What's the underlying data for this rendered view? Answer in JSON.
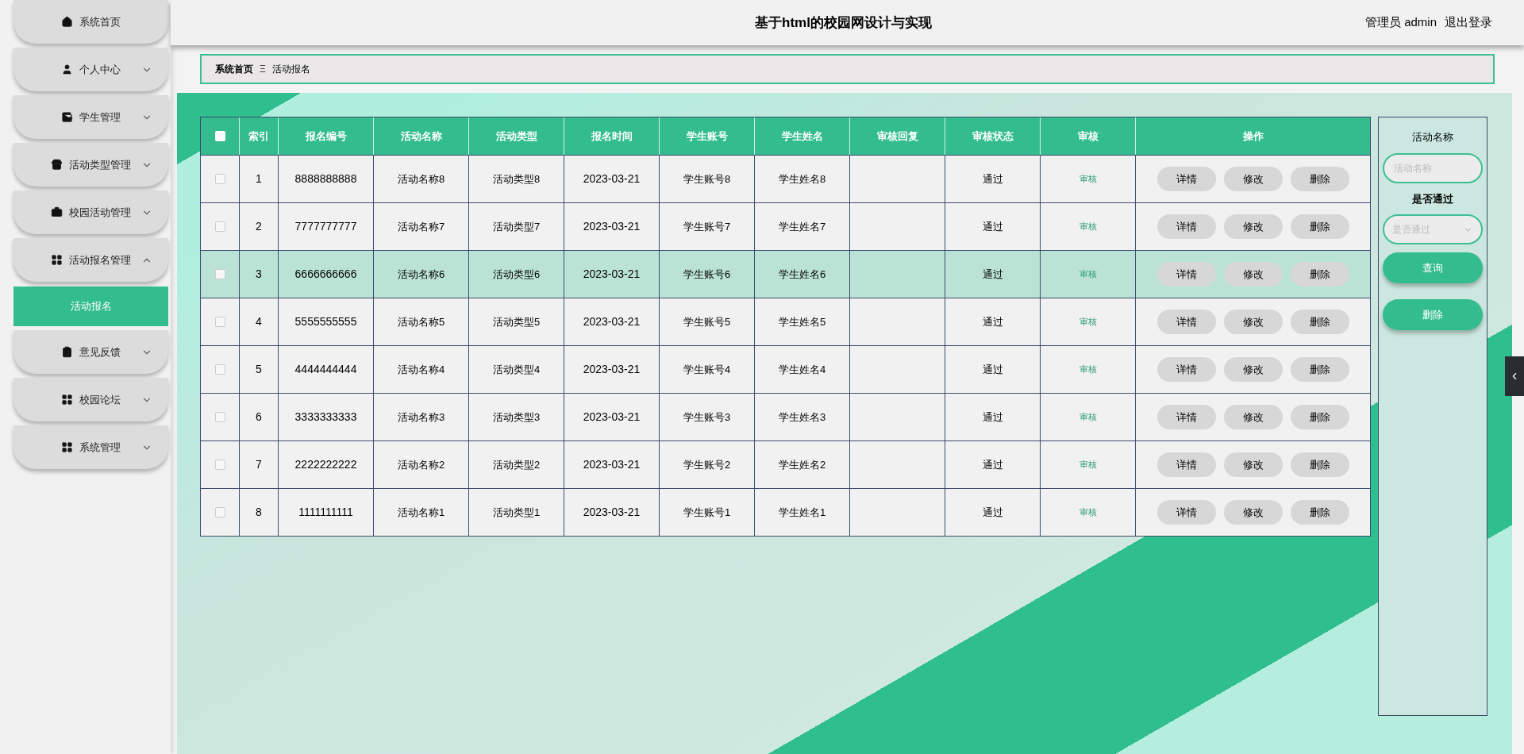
{
  "sidebar": {
    "items": [
      {
        "label": "系统首页",
        "kind": "link"
      },
      {
        "label": "个人中心",
        "kind": "menu",
        "expanded": false
      },
      {
        "label": "学生管理",
        "kind": "menu",
        "expanded": false
      },
      {
        "label": "活动类型管理",
        "kind": "menu",
        "expanded": false
      },
      {
        "label": "校园活动管理",
        "kind": "menu",
        "expanded": false
      },
      {
        "label": "活动报名管理",
        "kind": "menu",
        "expanded": true,
        "children": [
          {
            "label": "活动报名",
            "selected": true
          }
        ]
      },
      {
        "label": "意见反馈",
        "kind": "menu",
        "expanded": false
      },
      {
        "label": "校园论坛",
        "kind": "menu",
        "expanded": false
      },
      {
        "label": "系统管理",
        "kind": "menu",
        "expanded": false
      }
    ]
  },
  "header": {
    "title": "基于html的校园网设计与实现",
    "user": "管理员 admin",
    "logout": "退出登录"
  },
  "breadcrumb": {
    "home": "系统首页",
    "separator": "Ξ",
    "current": "活动报名"
  },
  "table": {
    "columns": [
      "索引",
      "报名编号",
      "活动名称",
      "活动类型",
      "报名时间",
      "学生账号",
      "学生姓名",
      "审核回复",
      "审核状态",
      "审核",
      "操作"
    ],
    "header_checked": false,
    "rows": [
      {
        "cells": [
          "1",
          "8888888888",
          "活动名称8",
          "活动类型8",
          "2023-03-21",
          "学生账号8",
          "学生姓名8",
          "",
          "通过"
        ],
        "review": "审核",
        "actions": [
          "详情",
          "修改",
          "删除"
        ],
        "checked": false,
        "selected": false
      },
      {
        "cells": [
          "2",
          "7777777777",
          "活动名称7",
          "活动类型7",
          "2023-03-21",
          "学生账号7",
          "学生姓名7",
          "",
          "通过"
        ],
        "review": "审核",
        "actions": [
          "详情",
          "修改",
          "删除"
        ],
        "checked": false,
        "selected": false
      },
      {
        "cells": [
          "3",
          "6666666666",
          "活动名称6",
          "活动类型6",
          "2023-03-21",
          "学生账号6",
          "学生姓名6",
          "",
          "通过"
        ],
        "review": "审核",
        "actions": [
          "详情",
          "修改",
          "删除"
        ],
        "checked": false,
        "selected": true
      },
      {
        "cells": [
          "4",
          "5555555555",
          "活动名称5",
          "活动类型5",
          "2023-03-21",
          "学生账号5",
          "学生姓名5",
          "",
          "通过"
        ],
        "review": "审核",
        "actions": [
          "详情",
          "修改",
          "删除"
        ],
        "checked": false,
        "selected": false
      },
      {
        "cells": [
          "5",
          "4444444444",
          "活动名称4",
          "活动类型4",
          "2023-03-21",
          "学生账号4",
          "学生姓名4",
          "",
          "通过"
        ],
        "review": "审核",
        "actions": [
          "详情",
          "修改",
          "删除"
        ],
        "checked": false,
        "selected": false
      },
      {
        "cells": [
          "6",
          "3333333333",
          "活动名称3",
          "活动类型3",
          "2023-03-21",
          "学生账号3",
          "学生姓名3",
          "",
          "通过"
        ],
        "review": "审核",
        "actions": [
          "详情",
          "修改",
          "删除"
        ],
        "checked": false,
        "selected": false
      },
      {
        "cells": [
          "7",
          "2222222222",
          "活动名称2",
          "活动类型2",
          "2023-03-21",
          "学生账号2",
          "学生姓名2",
          "",
          "通过"
        ],
        "review": "审核",
        "actions": [
          "详情",
          "修改",
          "删除"
        ],
        "checked": false,
        "selected": false
      },
      {
        "cells": [
          "8",
          "1111111111",
          "活动名称1",
          "活动类型1",
          "2023-03-21",
          "学生账号1",
          "学生姓名1",
          "",
          "通过"
        ],
        "review": "审核",
        "actions": [
          "详情",
          "修改",
          "删除"
        ],
        "checked": false,
        "selected": false
      }
    ]
  },
  "search": {
    "name_label": "活动名称",
    "name_placeholder": "活动名称",
    "status_label": "是否通过",
    "status_placeholder": "是否通过",
    "query_button": "查询",
    "delete_button": "删除"
  }
}
